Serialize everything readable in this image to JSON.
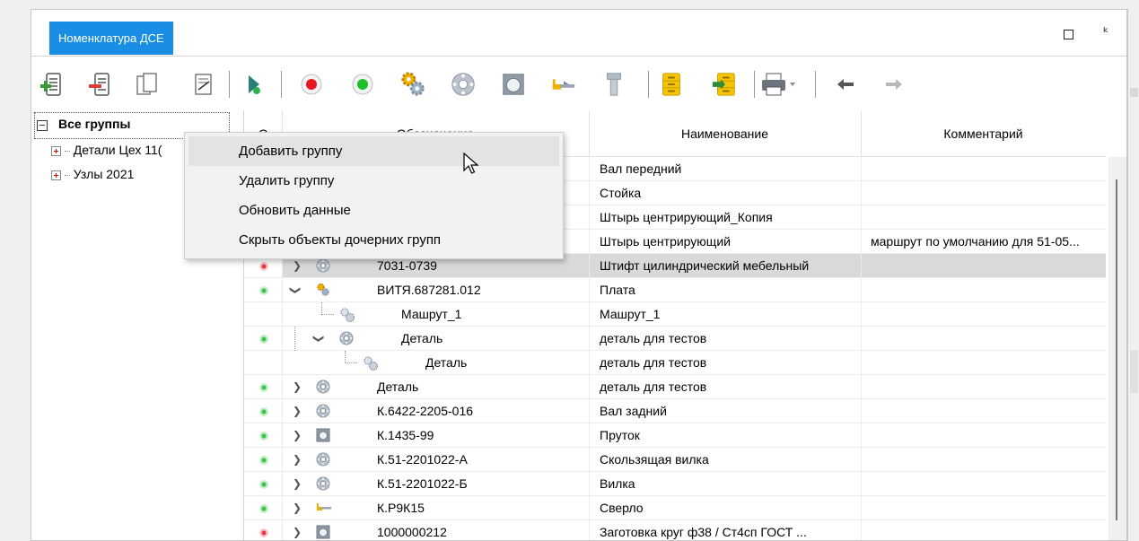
{
  "window": {
    "tab_title": "Номенклатура ДСЕ",
    "maximize_icon": "maximize-icon",
    "pin_icon": "pin-icon"
  },
  "toolbar": {
    "buttons": [
      "add-row-icon",
      "remove-row-icon",
      "copy-icon",
      "edit-icon",
      "run-icon",
      "record-red-icon",
      "record-green-icon",
      "gears-icon",
      "part-icon",
      "blank-icon",
      "tool-icon",
      "bolt-icon",
      "cabinet-icon",
      "cabinet-arrow-icon",
      "print-icon",
      "back-arrow-icon",
      "forward-arrow-icon"
    ]
  },
  "tree": {
    "root": {
      "label": "Все группы"
    },
    "items": [
      {
        "label": "Детали Цех 11("
      },
      {
        "label": "Узлы 2021"
      }
    ]
  },
  "grid": {
    "columns": {
      "status": "С",
      "designation": "Обозначение",
      "name": "Наименование",
      "comment": "Комментарий"
    },
    "rows": [
      {
        "status": "",
        "expand": "",
        "icon": "",
        "designation": "",
        "name": "Вал передний",
        "comment": ""
      },
      {
        "status": "",
        "expand": "",
        "icon": "",
        "designation": "",
        "name": "Стойка",
        "comment": ""
      },
      {
        "status": "",
        "expand": "",
        "icon": "",
        "designation": "",
        "name": "Штырь центрирующий_Копия",
        "comment": ""
      },
      {
        "status": "",
        "expand": "",
        "icon": "",
        "designation": "",
        "name": "Штырь центрирующий",
        "comment": "маршрут по умолчанию для 51-05..."
      },
      {
        "status": "red",
        "expand": "collapsed",
        "icon": "part",
        "designation": "7031-0739",
        "name": "Штифт цилиндрический мебельный",
        "comment": "",
        "selected": true
      },
      {
        "status": "green",
        "expand": "expanded",
        "icon": "gears",
        "designation": "ВИТЯ.687281.012",
        "name": "Плата",
        "comment": ""
      },
      {
        "status": "",
        "expand": "",
        "icon": "route",
        "designation": "Машрут_1",
        "name": "Машрут_1",
        "comment": "",
        "level": 1
      },
      {
        "status": "green",
        "expand": "expanded",
        "icon": "part",
        "designation": "Деталь",
        "name": "деталь для тестов",
        "comment": "",
        "level": 1
      },
      {
        "status": "",
        "expand": "",
        "icon": "route",
        "designation": "Деталь",
        "name": "деталь для тестов",
        "comment": "",
        "level": 2
      },
      {
        "status": "green",
        "expand": "collapsed",
        "icon": "part",
        "designation": "Деталь",
        "name": "деталь для тестов",
        "comment": ""
      },
      {
        "status": "green",
        "expand": "collapsed",
        "icon": "part",
        "designation": "К.6422-2205-016",
        "name": "Вал задний",
        "comment": ""
      },
      {
        "status": "green",
        "expand": "collapsed",
        "icon": "blank",
        "designation": "К.1435-99",
        "name": "Пруток",
        "comment": ""
      },
      {
        "status": "green",
        "expand": "collapsed",
        "icon": "part",
        "designation": "К.51-2201022-А",
        "name": "Скользящая вилка",
        "comment": ""
      },
      {
        "status": "green",
        "expand": "collapsed",
        "icon": "part",
        "designation": "К.51-2201022-Б",
        "name": "Вилка",
        "comment": ""
      },
      {
        "status": "green",
        "expand": "collapsed",
        "icon": "tool",
        "designation": "К.Р9К15",
        "name": "Сверло",
        "comment": ""
      },
      {
        "status": "red",
        "expand": "collapsed",
        "icon": "blank",
        "designation": "1000000212",
        "name": "Заготовка круг ф38 / Ст4сп ГОСТ ...",
        "comment": ""
      }
    ]
  },
  "context_menu": {
    "items": [
      {
        "label": "Добавить группу",
        "hover": true
      },
      {
        "label": "Удалить группу"
      },
      {
        "label": "Обновить данные"
      },
      {
        "label": "Скрыть объекты дочерних групп"
      }
    ]
  },
  "colors": {
    "accent": "#1a8ee4",
    "status_green": "#3bc24a",
    "status_red": "#e2383f",
    "selected_row": "#d9d9d9"
  }
}
